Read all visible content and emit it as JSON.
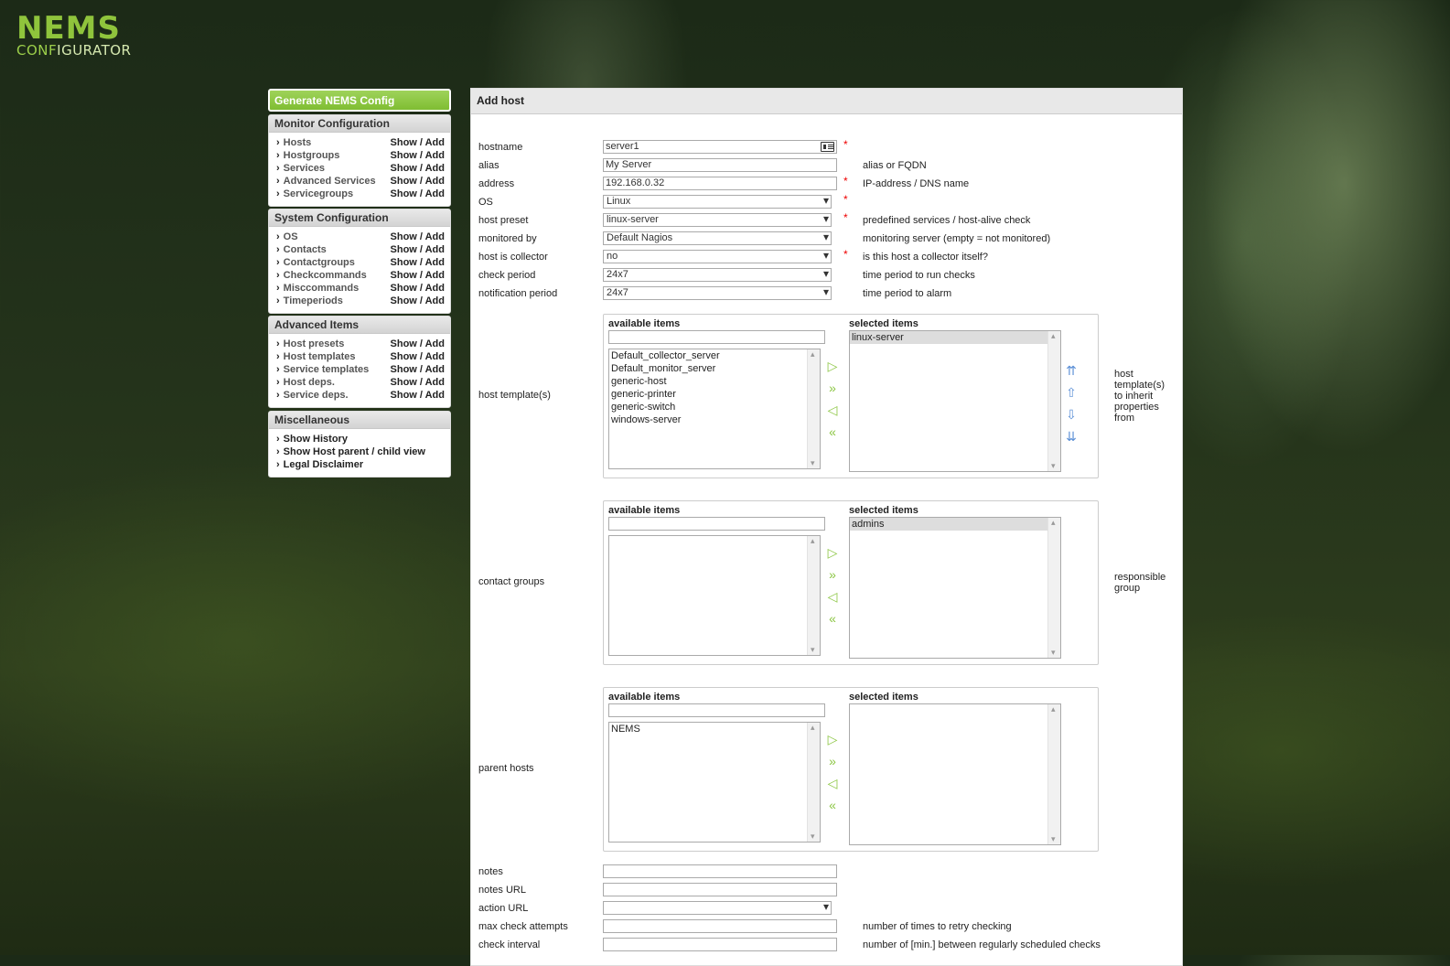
{
  "logo": {
    "line1": "NEMS",
    "line2a": "CONF",
    "line2b": "IGURATOR"
  },
  "sidebar": {
    "generate_label": "Generate NEMS Config",
    "monitor": {
      "title": "Monitor Configuration",
      "items": [
        {
          "label": "Hosts",
          "action": "Show / Add"
        },
        {
          "label": "Hostgroups",
          "action": "Show / Add"
        },
        {
          "label": "Services",
          "action": "Show / Add"
        },
        {
          "label": "Advanced Services",
          "action": "Show / Add"
        },
        {
          "label": "Servicegroups",
          "action": "Show / Add"
        }
      ]
    },
    "system": {
      "title": "System Configuration",
      "items": [
        {
          "label": "OS",
          "action": "Show / Add"
        },
        {
          "label": "Contacts",
          "action": "Show / Add"
        },
        {
          "label": "Contactgroups",
          "action": "Show / Add"
        },
        {
          "label": "Checkcommands",
          "action": "Show / Add"
        },
        {
          "label": "Misccommands",
          "action": "Show / Add"
        },
        {
          "label": "Timeperiods",
          "action": "Show / Add"
        }
      ]
    },
    "advanced": {
      "title": "Advanced Items",
      "items": [
        {
          "label": "Host presets",
          "action": "Show / Add"
        },
        {
          "label": "Host templates",
          "action": "Show / Add"
        },
        {
          "label": "Service templates",
          "action": "Show / Add"
        },
        {
          "label": "Host deps.",
          "action": "Show / Add"
        },
        {
          "label": "Service deps.",
          "action": "Show / Add"
        }
      ]
    },
    "misc": {
      "title": "Miscellaneous",
      "items": [
        "Show History",
        "Show Host parent / child view",
        "Legal Disclaimer"
      ]
    }
  },
  "form": {
    "title": "Add host",
    "hostname": {
      "label": "hostname",
      "value": "server1",
      "required": "*"
    },
    "alias": {
      "label": "alias",
      "value": "My Server",
      "hint": "alias or FQDN"
    },
    "address": {
      "label": "address",
      "value": "192.168.0.32",
      "required": "*",
      "hint": "IP-address / DNS name"
    },
    "os": {
      "label": "OS",
      "value": "Linux",
      "required": "*"
    },
    "host_preset": {
      "label": "host preset",
      "value": "linux-server",
      "required": "*",
      "hint": "predefined services / host-alive check"
    },
    "monitored_by": {
      "label": "monitored by",
      "value": "Default Nagios",
      "hint": "monitoring server (empty = not monitored)"
    },
    "host_is_collector": {
      "label": "host is collector",
      "value": "no",
      "required": "*",
      "hint": "is this host a collector itself?"
    },
    "check_period": {
      "label": "check period",
      "value": "24x7",
      "hint": "time period to run checks"
    },
    "notification_period": {
      "label": "notification period",
      "value": "24x7",
      "hint": "time period to alarm"
    },
    "available_label": "available items",
    "selected_label": "selected items",
    "host_templates": {
      "label": "host template(s)",
      "available": [
        "Default_collector_server",
        "Default_monitor_server",
        "generic-host",
        "generic-printer",
        "generic-switch",
        "windows-server"
      ],
      "selected": [
        "linux-server"
      ],
      "hint": "host template(s) to inherit properties from"
    },
    "contact_groups": {
      "label": "contact groups",
      "available": [],
      "selected": [
        "admins"
      ],
      "hint": "responsible group"
    },
    "parent_hosts": {
      "label": "parent hosts",
      "available": [
        "NEMS"
      ],
      "selected": []
    },
    "notes": {
      "label": "notes",
      "value": ""
    },
    "notes_url": {
      "label": "notes URL",
      "value": ""
    },
    "action_url": {
      "label": "action URL",
      "value": ""
    },
    "max_check_attempts": {
      "label": "max check attempts",
      "value": "",
      "hint": "number of times to retry checking"
    },
    "check_interval": {
      "label": "check interval",
      "value": "",
      "hint": "number of [min.] between regularly scheduled checks"
    }
  }
}
